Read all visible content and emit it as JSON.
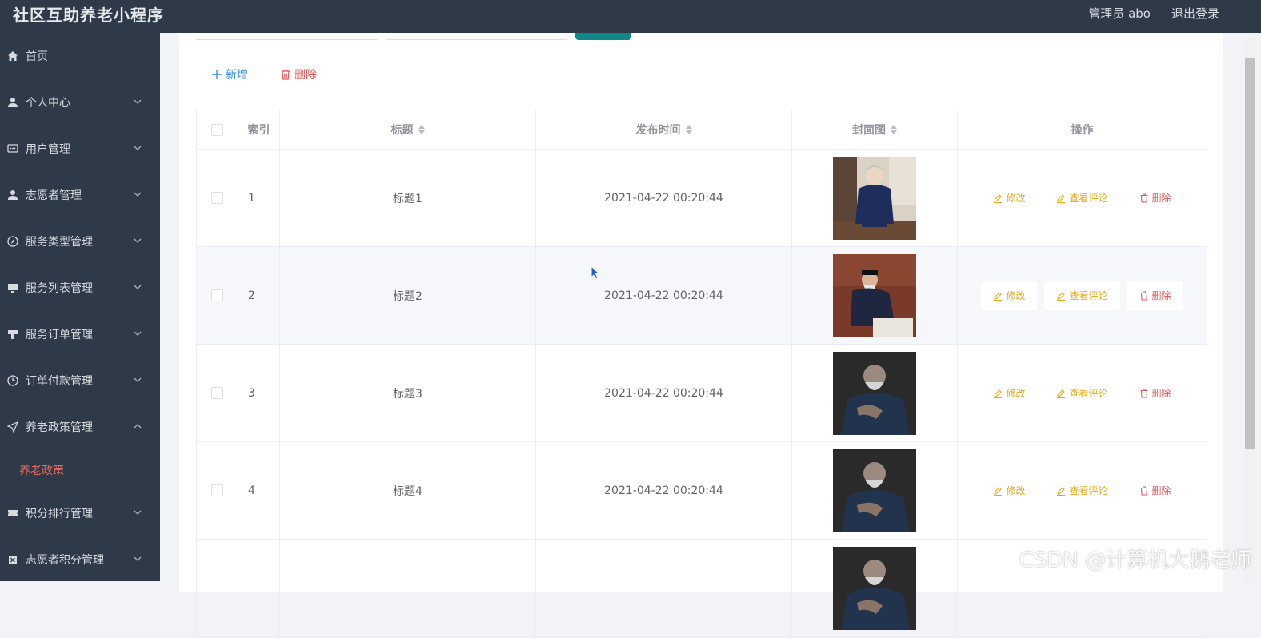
{
  "header": {
    "title": "社区互助养老小程序",
    "user_label": "管理员 abo",
    "logout_label": "退出登录"
  },
  "sidebar": {
    "items": [
      {
        "label": "首页",
        "icon": "home-icon",
        "expandable": false
      },
      {
        "label": "个人中心",
        "icon": "user-icon",
        "expandable": true
      },
      {
        "label": "用户管理",
        "icon": "chat-icon",
        "expandable": true
      },
      {
        "label": "志愿者管理",
        "icon": "user-icon",
        "expandable": true
      },
      {
        "label": "服务类型管理",
        "icon": "compass-icon",
        "expandable": true
      },
      {
        "label": "服务列表管理",
        "icon": "monitor-icon",
        "expandable": true
      },
      {
        "label": "服务订单管理",
        "icon": "stamp-icon",
        "expandable": true
      },
      {
        "label": "订单付款管理",
        "icon": "clock-icon",
        "expandable": true
      },
      {
        "label": "养老政策管理",
        "icon": "send-icon",
        "expandable": true,
        "expanded": true
      },
      {
        "label": "积分排行管理",
        "icon": "ticket-icon",
        "expandable": true
      },
      {
        "label": "志愿者积分管理",
        "icon": "delete-icon",
        "expandable": true
      }
    ],
    "active_submenu": "养老政策"
  },
  "toolbar": {
    "add_label": "新增",
    "delete_label": "删除"
  },
  "table": {
    "columns": {
      "index": "索引",
      "title": "标题",
      "publish_time": "发布时间",
      "cover": "封面图",
      "actions": "操作"
    },
    "rows": [
      {
        "index": "1",
        "title": "标题1",
        "publish_time": "2021-04-22 00:20:44",
        "cover": "cover-woman-seated"
      },
      {
        "index": "2",
        "title": "标题2",
        "publish_time": "2021-04-22 00:20:44",
        "cover": "cover-man-writing"
      },
      {
        "index": "3",
        "title": "标题3",
        "publish_time": "2021-04-22 00:20:44",
        "cover": "cover-man-portrait"
      },
      {
        "index": "4",
        "title": "标题4",
        "publish_time": "2021-04-22 00:20:44",
        "cover": "cover-man-portrait"
      },
      {
        "index": "",
        "title": "",
        "publish_time": "",
        "cover": "cover-man-portrait"
      }
    ],
    "row_actions": {
      "edit": "修改",
      "view_comments": "查看评论",
      "delete": "删除"
    }
  },
  "watermark": "CSDN @计算机大鹅老师",
  "colors": {
    "sidebar_bg": "#2e3a47",
    "accent_teal": "#12878b",
    "primary_blue": "#3a8ee6",
    "warning": "#e6a817",
    "danger": "#e05a5a",
    "active_submenu": "#f06a5e"
  }
}
